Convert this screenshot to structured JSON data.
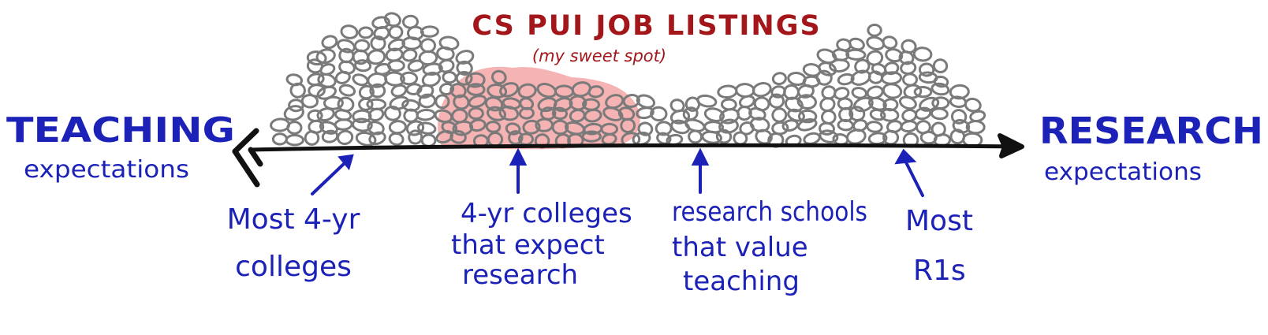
{
  "title": "CS PUI JOB LISTINGS",
  "subtitle": "(my sweet spot)",
  "axis": {
    "left_label": "TEACHING",
    "left_sublabel": "expectations",
    "right_label": "RESEARCH",
    "right_sublabel": "expectations"
  },
  "annotations": [
    {
      "lines": [
        "Most 4-yr",
        "colleges"
      ]
    },
    {
      "lines": [
        "4-yr colleges",
        "that expect",
        "research"
      ]
    },
    {
      "lines": [
        "research schools",
        "that value",
        "teaching"
      ]
    },
    {
      "lines": [
        "Most",
        "R1s"
      ]
    }
  ],
  "colors": {
    "ink_blue": "#1c22b8",
    "title_red": "#a3161a",
    "blob_gray": "#7a7a7a",
    "highlight_pink": "#f4a6a6",
    "axis_black": "#111111"
  }
}
